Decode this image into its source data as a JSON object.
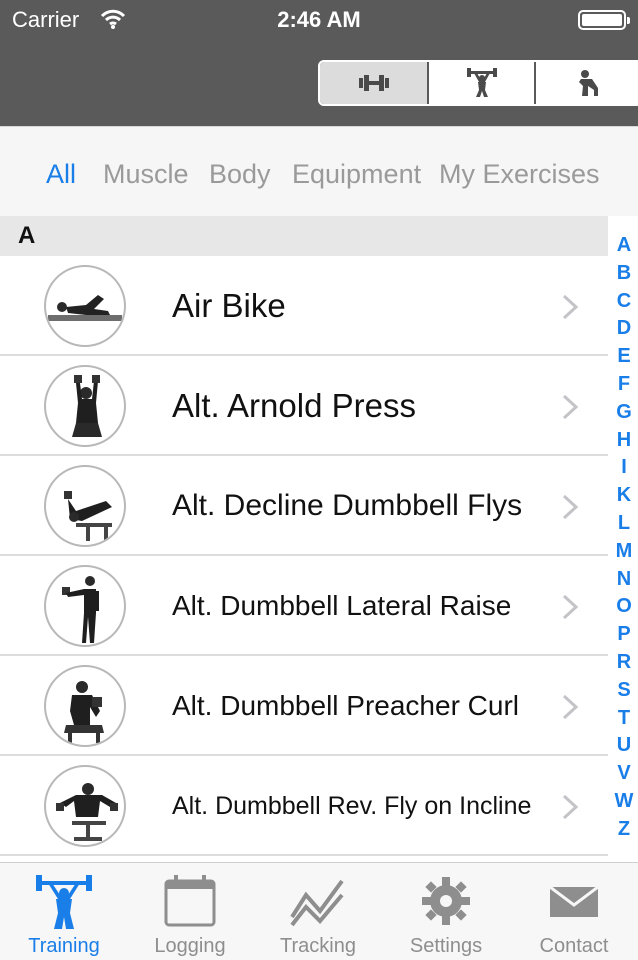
{
  "status": {
    "carrier": "Carrier",
    "time": "2:46 AM"
  },
  "segments": [
    {
      "icon": "dumbbell-icon",
      "selected": true
    },
    {
      "icon": "weightlifter-icon",
      "selected": false
    },
    {
      "icon": "stretch-icon",
      "selected": false
    }
  ],
  "filters": {
    "all": "All",
    "muscle": "Muscle",
    "body": "Body",
    "equipment": "Equipment",
    "my_exercises": "My Exercises",
    "active": "All"
  },
  "section": "A",
  "exercises": [
    {
      "name": "Air Bike"
    },
    {
      "name": "Alt. Arnold Press"
    },
    {
      "name": "Alt. Decline Dumbbell Flys"
    },
    {
      "name": "Alt. Dumbbell Lateral Raise"
    },
    {
      "name": "Alt. Dumbbell Preacher Curl"
    },
    {
      "name": "Alt. Dumbbell Rev. Fly on Incline"
    }
  ],
  "index_letters": [
    "A",
    "B",
    "C",
    "D",
    "E",
    "F",
    "G",
    "H",
    "I",
    "K",
    "L",
    "M",
    "N",
    "O",
    "P",
    "R",
    "S",
    "T",
    "U",
    "V",
    "W",
    "Z"
  ],
  "tabbar": {
    "training": "Training",
    "logging": "Logging",
    "tracking": "Tracking",
    "settings": "Settings",
    "contact": "Contact",
    "active": "Training"
  },
  "colors": {
    "accent": "#1a7ee8",
    "header": "#5a5a5a",
    "inactive": "#8e8e8e"
  }
}
